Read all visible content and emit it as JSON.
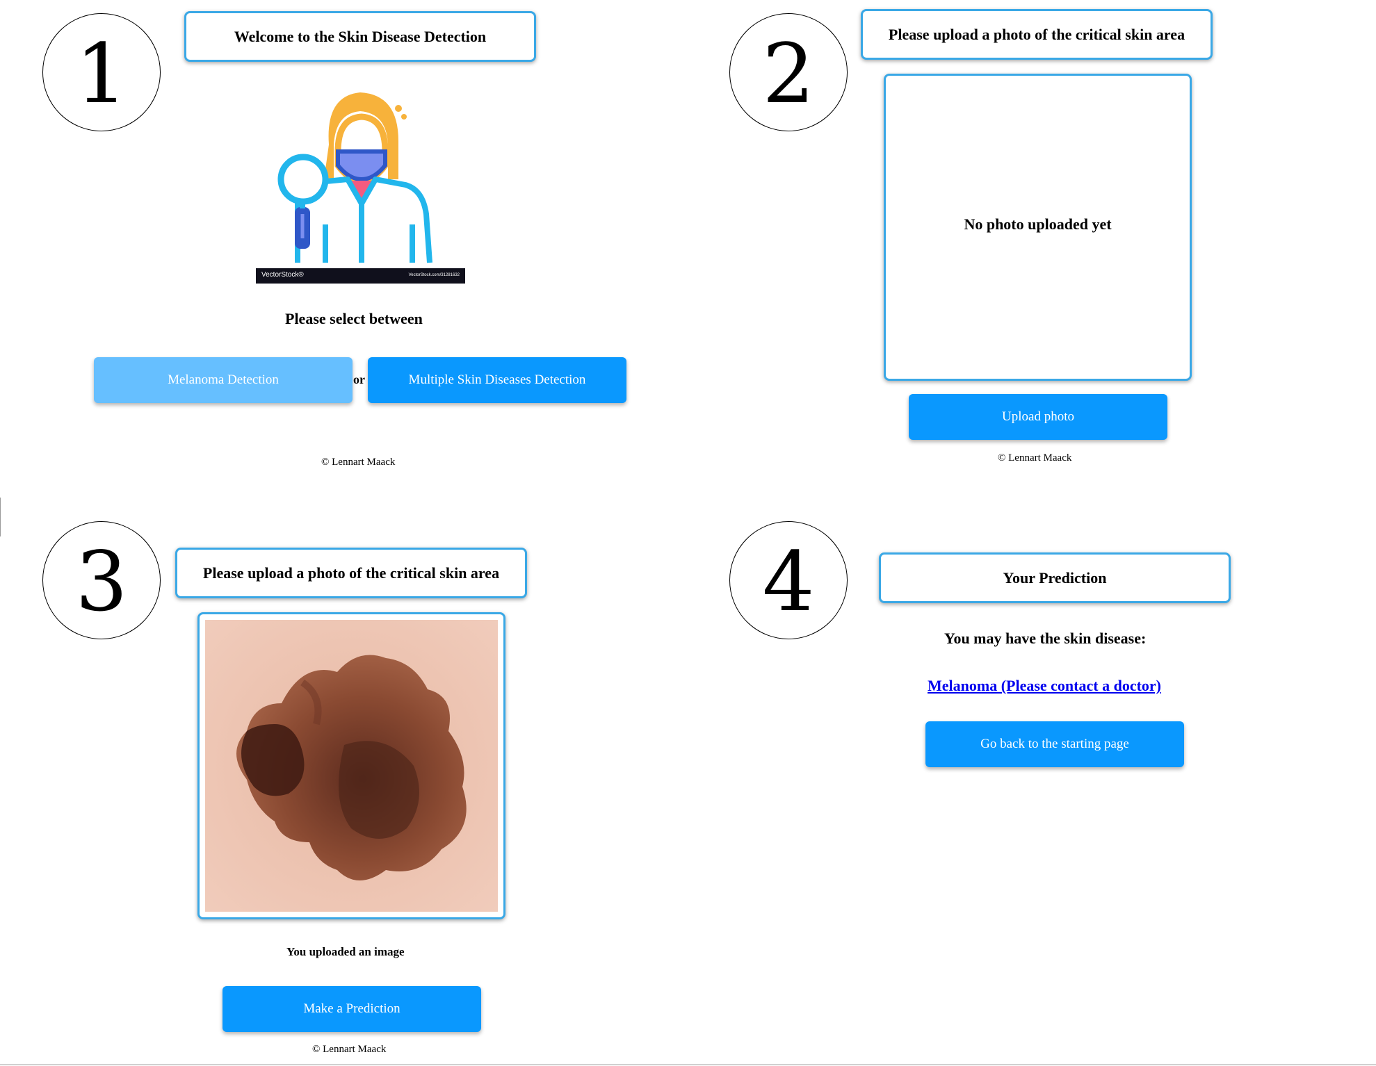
{
  "steps": {
    "one": "1",
    "two": "2",
    "three": "3",
    "four": "4"
  },
  "screen1": {
    "title": "Welcome to the Skin Disease Detection",
    "illustration_icon": "doctor-with-magnifier-icon",
    "watermark_left": "VectorStock®",
    "watermark_right": "VectorStock.com/31281632",
    "select_label": "Please select between",
    "melanoma_button": "Melanoma Detection",
    "or_label": "or",
    "multiple_button": "Multiple Skin Diseases Detection",
    "footer": "© Lennart Maack"
  },
  "screen2": {
    "title": "Please upload a photo of the critical skin area",
    "placeholder": "No photo uploaded yet",
    "upload_button": "Upload photo",
    "footer": "© Lennart Maack"
  },
  "screen3": {
    "title": "Please upload a photo of the critical skin area",
    "uploaded_image": "melanoma-skin-lesion-photo",
    "status": "You uploaded an image",
    "predict_button": "Make a Prediction",
    "footer": "© Lennart Maack"
  },
  "screen4": {
    "title": "Your Prediction",
    "message": "You may have the skin disease:",
    "result_link": "Melanoma (Please contact a doctor)",
    "back_button": "Go back to the starting page"
  },
  "colors": {
    "accent": "#0a98fe",
    "accent_light": "#66bfff",
    "border": "#3aa8e6",
    "link": "#0000ee"
  }
}
